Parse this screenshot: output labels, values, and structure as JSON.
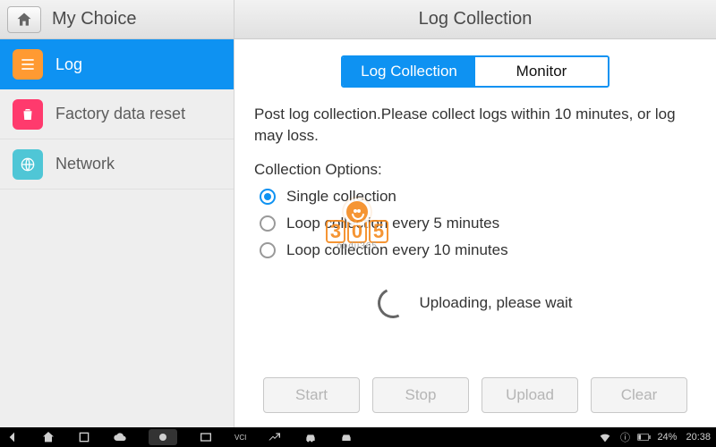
{
  "header": {
    "left_title": "My Choice",
    "right_title": "Log Collection"
  },
  "sidebar": {
    "items": [
      {
        "label": "Log",
        "icon": "list-icon",
        "active": true
      },
      {
        "label": "Factory data reset",
        "icon": "trash-icon",
        "active": false
      },
      {
        "label": "Network",
        "icon": "globe-icon",
        "active": false
      }
    ]
  },
  "tabs": {
    "items": [
      {
        "label": "Log Collection",
        "active": true
      },
      {
        "label": "Monitor",
        "active": false
      }
    ]
  },
  "description": "Post log collection.Please collect logs within 10 minutes, or log may loss.",
  "options_title": "Collection Options:",
  "options": [
    {
      "label": "Single collection",
      "checked": true
    },
    {
      "label": "Loop collection every 5 minutes",
      "checked": false
    },
    {
      "label": "Loop collection every 10 minutes",
      "checked": false
    }
  ],
  "status_text": "Uploading, please wait",
  "buttons": {
    "start": "Start",
    "stop": "Stop",
    "upload": "Upload",
    "clear": "Clear"
  },
  "watermark": {
    "digits": [
      "3",
      "0",
      "5"
    ],
    "sub": "obdii365"
  },
  "sysbar": {
    "battery_pct": "24%",
    "time": "20:38"
  }
}
